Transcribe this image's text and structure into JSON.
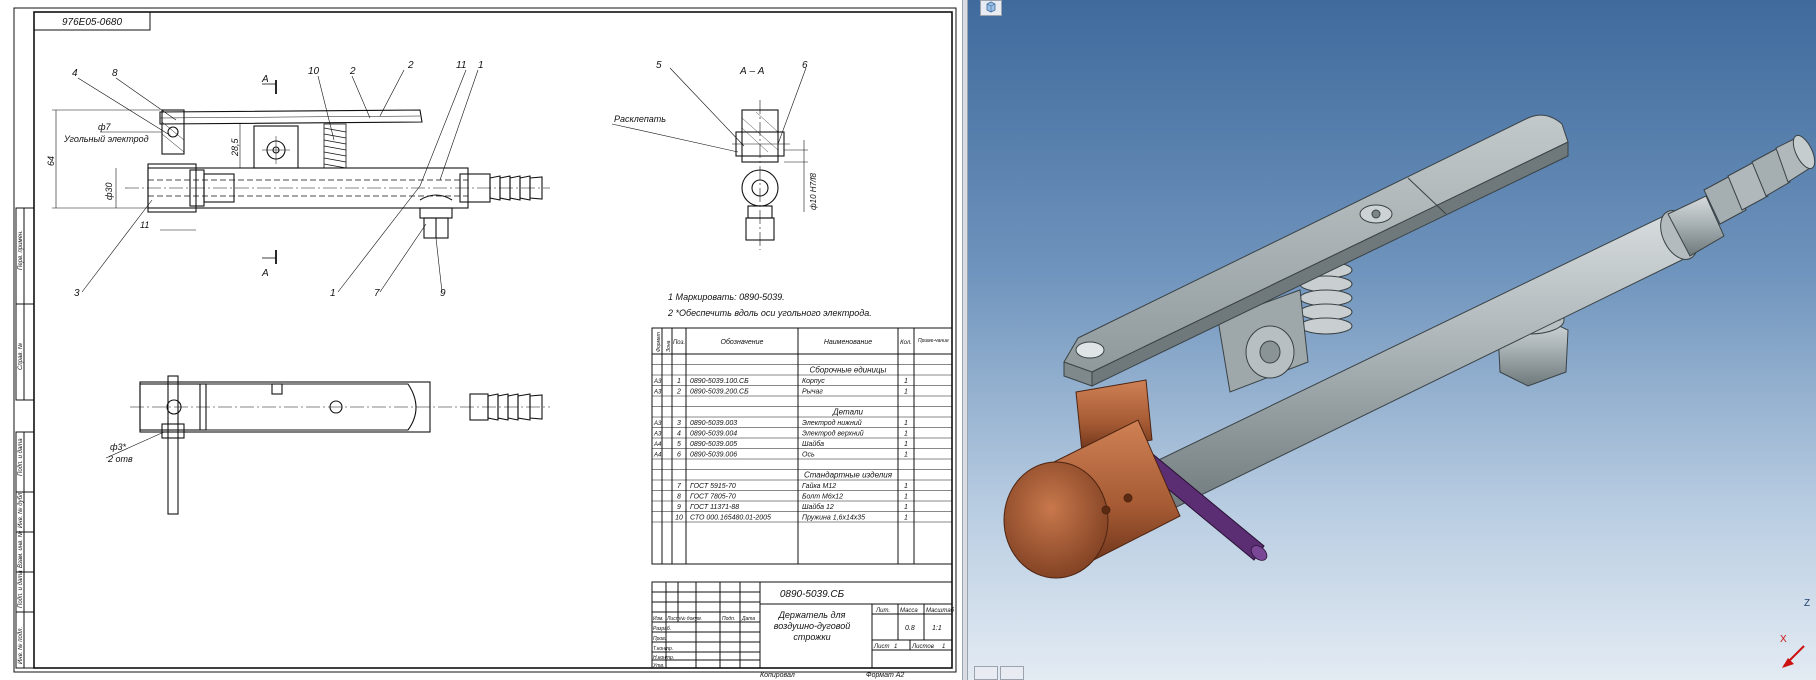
{
  "stamp_top": "976Е05-0680",
  "view_labels": {
    "section_a": "А",
    "section_title": "А – А"
  },
  "callouts": {
    "n1": "1",
    "n2": "2",
    "n3": "3",
    "n4": "4",
    "n5": "5",
    "n6": "6",
    "n7": "7",
    "n8": "8",
    "n9": "9",
    "n10": "10",
    "n11": "11"
  },
  "dimensions": {
    "d64": "64",
    "d285": "28,5",
    "d30": "ф30",
    "d11": "11",
    "d7": "ф7",
    "electrode": "Угольный электрод",
    "rivet": "Расклепать",
    "holes": "ф3*",
    "holes_count": "2 отв",
    "fit": "ф10 H7/f8"
  },
  "side_labels": [
    "Перв. примен.",
    "Справ. №",
    "Подп. и дата",
    "Инв. № дубл.",
    "Взам. инв. №",
    "Подп. и дата",
    "Инв. № подл."
  ],
  "notes": [
    "1 Маркировать: 0890-5039.",
    "2 *Обеспечить вдоль оси угольного электрода."
  ],
  "spec": {
    "headers": [
      "Формат",
      "Зона",
      "Поз.",
      "Обозначение",
      "Наименование",
      "Кол.",
      "Приме-чание"
    ],
    "sections": {
      "assemblies": "Сборочные единицы",
      "details": "Детали",
      "standard": "Стандартные изделия"
    },
    "rows_assemblies": [
      {
        "fmt": "А3",
        "pos": "1",
        "code": "0890-5039.100.СБ",
        "name": "Корпус",
        "qty": "1"
      },
      {
        "fmt": "А3",
        "pos": "2",
        "code": "0890-5039.200.СБ",
        "name": "Рычаг",
        "qty": "1"
      }
    ],
    "rows_details": [
      {
        "fmt": "А3",
        "pos": "3",
        "code": "0890-5039.003",
        "name": "Электрод нижний",
        "qty": "1"
      },
      {
        "fmt": "А3",
        "pos": "4",
        "code": "0890-5039.004",
        "name": "Электрод верхний",
        "qty": "1"
      },
      {
        "fmt": "А4",
        "pos": "5",
        "code": "0890-5039.005",
        "name": "Шайба",
        "qty": "1"
      },
      {
        "fmt": "А4",
        "pos": "6",
        "code": "0890-5039.006",
        "name": "Ось",
        "qty": "1"
      }
    ],
    "rows_standard": [
      {
        "fmt": "",
        "pos": "7",
        "code": "ГОСТ 5915-70",
        "name": "Гайка М12",
        "qty": "1"
      },
      {
        "fmt": "",
        "pos": "8",
        "code": "ГОСТ 7805-70",
        "name": "Болт М6х12",
        "qty": "1"
      },
      {
        "fmt": "",
        "pos": "9",
        "code": "ГОСТ 11371-88",
        "name": "Шайба 12",
        "qty": "1"
      },
      {
        "fmt": "",
        "pos": "10",
        "code": "СТО 000.165480.01-2005",
        "name": "Пружина 1,6х14х35",
        "qty": "1"
      }
    ]
  },
  "title_block": {
    "designation": "0890-5039.СБ",
    "name_line1": "Держатель для",
    "name_line2": "воздушно-дуговой",
    "name_line3": "строжки",
    "lit": "Лит.",
    "mass": "Масса",
    "scale": "Масштаб",
    "mass_val": "0.8",
    "scale_val": "1:1",
    "sheet": "Лист",
    "sheet_val": "1",
    "sheets": "Листов",
    "sheets_val": "1",
    "rows": [
      "Изм.",
      "Лист",
      "№ докум.",
      "Подп.",
      "Дата"
    ],
    "roles": [
      "Разраб.",
      "Пров.",
      "Т.контр.",
      "Н.контр.",
      "Утв."
    ],
    "copied": "Копировал",
    "format": "Формат А2"
  },
  "axis_labels": {
    "x": "X",
    "z": "Z"
  },
  "colors": {
    "copper": "#b0643c",
    "steel": "#a8b1b4",
    "electrode": "#5b2d73",
    "bg_top": "#3f6a9c"
  }
}
